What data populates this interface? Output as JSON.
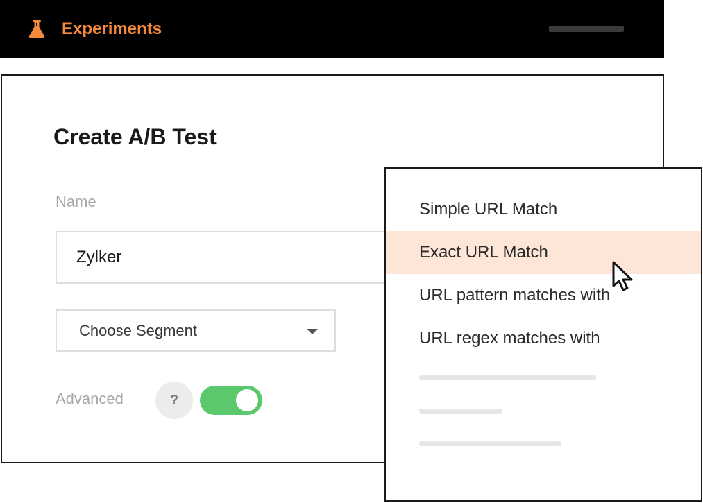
{
  "colors": {
    "accent": "#f5893d",
    "toggle_on": "#5cc86e",
    "highlight": "#fde6d8",
    "header_bg": "#000000"
  },
  "header": {
    "brand_icon": "flask-icon",
    "title": "Experiments",
    "menu_icon": "menu-bar-icon"
  },
  "form": {
    "title": "Create A/B Test",
    "name_label": "Name",
    "name_value": "Zylker",
    "segment_label": "Choose Segment",
    "segment_icon": "caret-down-icon",
    "advanced_label": "Advanced",
    "help_label": "?",
    "advanced_enabled": true
  },
  "dropdown": {
    "items": [
      {
        "label": "Simple URL Match",
        "active": false
      },
      {
        "label": "Exact URL Match",
        "active": true
      },
      {
        "label": "URL pattern matches with",
        "active": false
      },
      {
        "label": "URL regex matches with",
        "active": false
      }
    ],
    "cursor_icon": "pointer-cursor-icon"
  }
}
